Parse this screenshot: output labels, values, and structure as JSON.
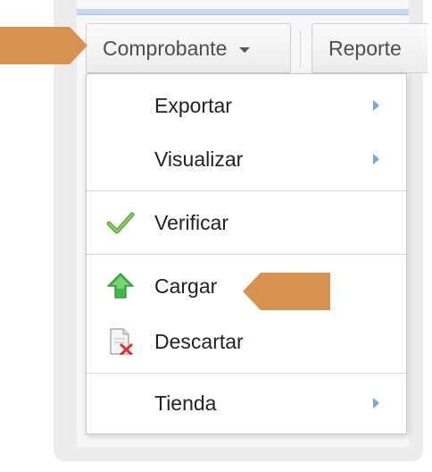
{
  "toolbar": {
    "comprobante_label": "Comprobante",
    "reportes_label": "Reporte"
  },
  "menu": {
    "exportar": "Exportar",
    "visualizar": "Visualizar",
    "verificar": "Verificar",
    "cargar": "Cargar",
    "descartar": "Descartar",
    "tienda": "Tienda"
  },
  "icons": {
    "verificar": "checkmark-icon",
    "cargar": "green-up-arrow-icon",
    "descartar": "document-delete-icon"
  },
  "colors": {
    "pointer": "#d9914f",
    "submenu_arrow": "#7aa6d8",
    "check": "#5aa83c",
    "arrow": "#43b84a"
  }
}
